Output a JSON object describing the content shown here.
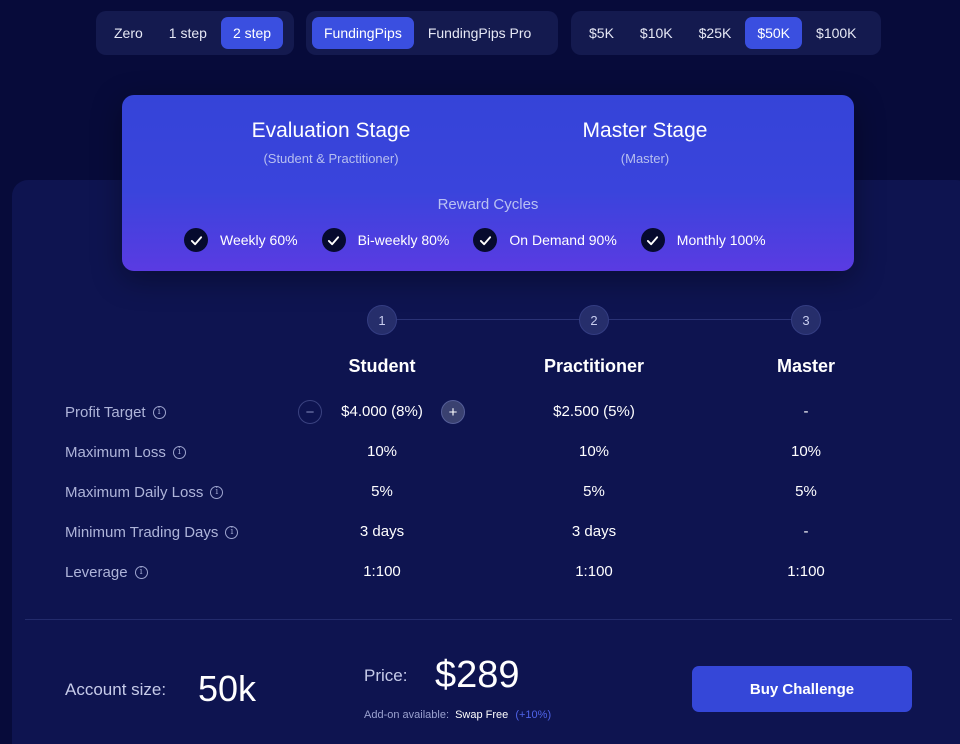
{
  "challenge_types": [
    {
      "label": "Zero",
      "active": false
    },
    {
      "label": "1 step",
      "active": false
    },
    {
      "label": "2 step",
      "active": true
    }
  ],
  "brands": [
    {
      "label": "FundingPips",
      "active": true
    },
    {
      "label": "FundingPips Pro",
      "active": false
    }
  ],
  "account_sizes": [
    {
      "label": "$5K",
      "active": false
    },
    {
      "label": "$10K",
      "active": false
    },
    {
      "label": "$25K",
      "active": false
    },
    {
      "label": "$50K",
      "active": true
    },
    {
      "label": "$100K",
      "active": false
    }
  ],
  "stages": {
    "evaluation": {
      "title": "Evaluation Stage",
      "subtitle": "(Student & Practitioner)"
    },
    "master": {
      "title": "Master Stage",
      "subtitle": "(Master)"
    },
    "reward_cycles_title": "Reward Cycles",
    "reward_cycles": [
      "Weekly 60%",
      "Bi-weekly 80%",
      "On Demand 90%",
      "Monthly 100%"
    ]
  },
  "steps": [
    "1",
    "2",
    "3"
  ],
  "columns": [
    "Student",
    "Practitioner",
    "Master"
  ],
  "rows": [
    {
      "label": "Profit Target",
      "values": [
        "$4.000 (8%)",
        "$2.500 (5%)",
        "-"
      ]
    },
    {
      "label": "Maximum Loss",
      "values": [
        "10%",
        "10%",
        "10%"
      ]
    },
    {
      "label": "Maximum Daily Loss",
      "values": [
        "5%",
        "5%",
        "5%"
      ]
    },
    {
      "label": "Minimum Trading Days",
      "values": [
        "3 days",
        "3 days",
        "-"
      ]
    },
    {
      "label": "Leverage",
      "values": [
        "1:100",
        "1:100",
        "1:100"
      ]
    }
  ],
  "stepper": {
    "minus": "−",
    "plus": "+"
  },
  "footer": {
    "account_size_label": "Account size:",
    "account_size_value": "50k",
    "price_label": "Price:",
    "price_value": "$289",
    "addon_prefix": "Add-on available:",
    "addon_name": "Swap Free",
    "addon_extra": "(+10%)",
    "buy_label": "Buy Challenge"
  },
  "colors": {
    "background": "#070b3a",
    "accent": "#3a4fe0",
    "card_gradient_top": "#3544d8",
    "card_gradient_bottom": "#5a3be2"
  }
}
